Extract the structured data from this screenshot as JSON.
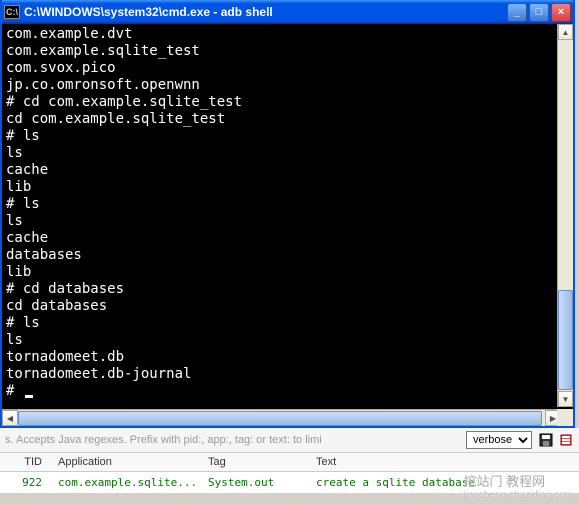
{
  "window": {
    "title": "C:\\WINDOWS\\system32\\cmd.exe - adb shell",
    "icon_label": "cmd"
  },
  "terminal": {
    "lines": [
      "com.example.dvt",
      "com.example.sqlite_test",
      "com.svox.pico",
      "jp.co.omronsoft.openwnn",
      "# cd com.example.sqlite_test",
      "cd com.example.sqlite_test",
      "# ls",
      "ls",
      "cache",
      "lib",
      "# ls",
      "ls",
      "cache",
      "databases",
      "lib",
      "# cd databases",
      "cd databases",
      "# ls",
      "ls",
      "tornadomeet.db",
      "tornadomeet.db-journal",
      "# "
    ]
  },
  "filter": {
    "hint": "s. Accepts Java regexes. Prefix with pid:, app:, tag: or text: to limi",
    "level": "verbose"
  },
  "log": {
    "headers": {
      "tid": "TID",
      "app": "Application",
      "tag": "Tag",
      "text": "Text"
    },
    "rows": [
      {
        "tid": "922",
        "app": "com.example.sqlite...",
        "tag": "System.out",
        "text": "create a sqlite database"
      }
    ]
  },
  "watermark": {
    "main": "挖站门 教程网",
    "url": "jiaocheng.chazidian.com"
  }
}
